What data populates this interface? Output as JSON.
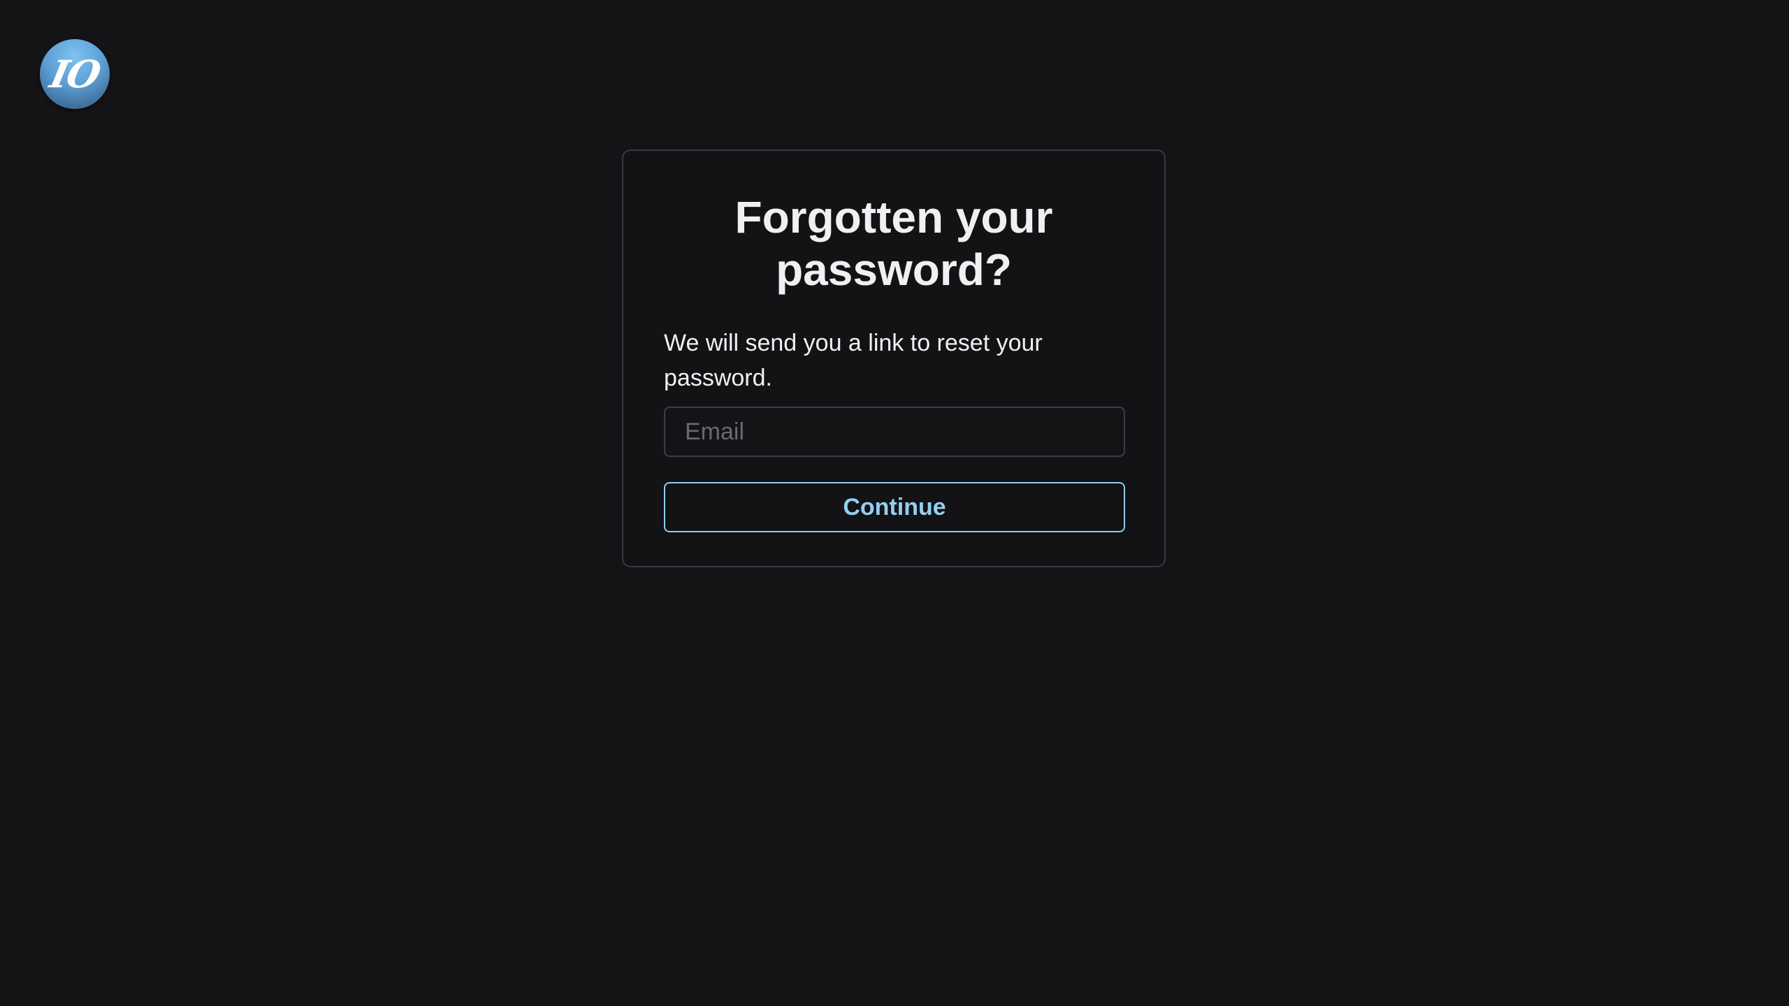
{
  "brand": {
    "logo_text": "IO",
    "icon": "io-logo-icon",
    "colors": [
      "#7cc3f2",
      "#3f6f97"
    ]
  },
  "form": {
    "title": "Forgotten your password?",
    "description": "We will send you a link to reset your password.",
    "email_placeholder": "Email",
    "email_value": "",
    "continue_label": "Continue"
  },
  "colors": {
    "background": "#141316",
    "accent": "#8fcdf1",
    "text": "#f0eff2",
    "border": "#3a393f"
  }
}
